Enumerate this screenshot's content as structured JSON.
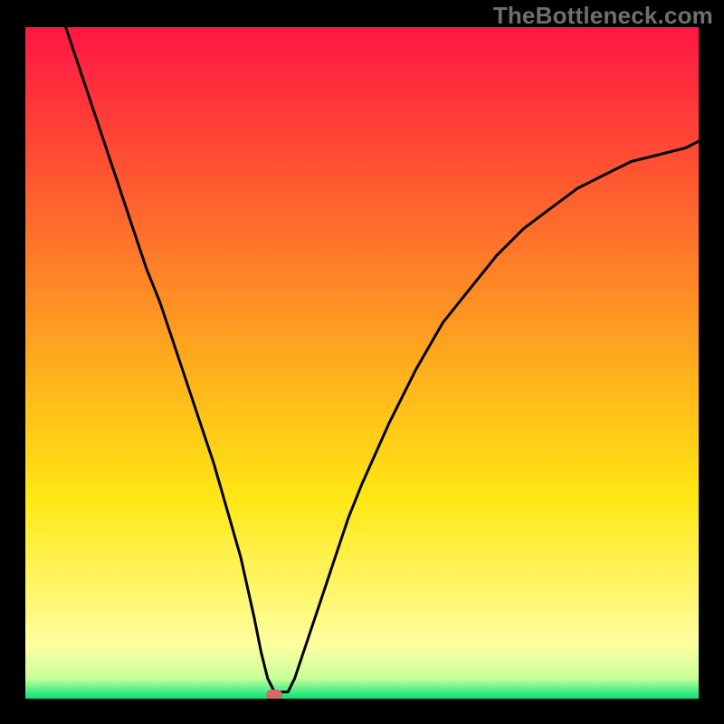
{
  "watermark": "TheBottleneck.com",
  "colors": {
    "frame_bg": "#000000",
    "marker": "#d46a6a",
    "curve": "#000000",
    "gradient_stops": [
      {
        "offset": "0%",
        "color": "#ff1744"
      },
      {
        "offset": "16%",
        "color": "#ff4336"
      },
      {
        "offset": "34%",
        "color": "#ff7a29"
      },
      {
        "offset": "52%",
        "color": "#ffb21c"
      },
      {
        "offset": "70%",
        "color": "#ffe714"
      },
      {
        "offset": "84%",
        "color": "#fff66a"
      },
      {
        "offset": "92%",
        "color": "#fdffa0"
      },
      {
        "offset": "97%",
        "color": "#c8ff9a"
      },
      {
        "offset": "100%",
        "color": "#00e47b"
      }
    ]
  },
  "chart_data": {
    "type": "line",
    "title": "",
    "xlabel": "",
    "ylabel": "",
    "xlim": [
      0,
      100
    ],
    "ylim": [
      0,
      100
    ],
    "minimum_marker": {
      "x": 37,
      "y": 0
    },
    "series": [
      {
        "name": "curve",
        "x": [
          6,
          8,
          10,
          12,
          14,
          16,
          18,
          20,
          22,
          24,
          26,
          28,
          30,
          32,
          34,
          35,
          36,
          37,
          38,
          39,
          40,
          42,
          44,
          46,
          48,
          50,
          54,
          58,
          62,
          66,
          70,
          74,
          78,
          82,
          86,
          90,
          94,
          98,
          100
        ],
        "y": [
          100,
          94,
          88,
          82,
          76,
          70,
          64,
          59,
          53,
          47,
          41,
          35,
          28,
          21,
          12,
          7,
          3,
          1,
          1,
          1,
          3,
          9,
          15,
          21,
          27,
          32,
          41,
          49,
          56,
          61,
          66,
          70,
          73,
          76,
          78,
          80,
          81,
          82,
          83
        ]
      }
    ]
  }
}
